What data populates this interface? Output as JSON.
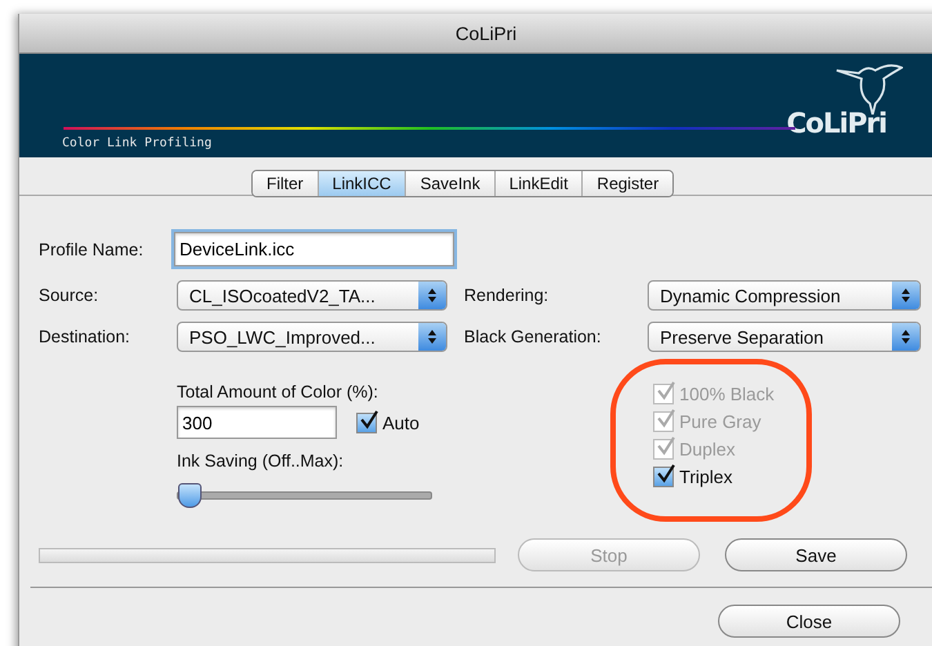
{
  "window": {
    "title": "CoLiPri"
  },
  "banner": {
    "logo": "CoLiPri",
    "tagline": "Color Link Profiling"
  },
  "tabs": [
    {
      "label": "Filter",
      "selected": false
    },
    {
      "label": "LinkICC",
      "selected": true
    },
    {
      "label": "SaveInk",
      "selected": false
    },
    {
      "label": "LinkEdit",
      "selected": false
    },
    {
      "label": "Register",
      "selected": false
    }
  ],
  "profile_name": {
    "label": "Profile Name:",
    "value": "DeviceLink.icc"
  },
  "popups": [
    {
      "label": "Source:",
      "value": "CL_ISOcoatedV2_TA..."
    },
    {
      "label": "Rendering:",
      "value": "Dynamic Compression"
    },
    {
      "label": "Destination:",
      "value": "PSO_LWC_Improved..."
    },
    {
      "label": "Black Generation:",
      "value": "Preserve Separation"
    }
  ],
  "total_amount": {
    "label": "Total Amount of Color (%):",
    "value": "300",
    "auto": {
      "label": "Auto",
      "checked": true
    }
  },
  "ink_saving": {
    "label": "Ink Saving (Off..Max):",
    "level": 0
  },
  "options": [
    {
      "label": "100% Black",
      "checked": true,
      "disabled": true
    },
    {
      "label": "Pure Gray",
      "checked": true,
      "disabled": true
    },
    {
      "label": "Duplex",
      "checked": true,
      "disabled": true
    },
    {
      "label": "Triplex",
      "checked": true,
      "disabled": false
    }
  ],
  "progress": {
    "level": 0
  },
  "buttons": [
    {
      "label": "Stop",
      "disabled": true
    },
    {
      "label": "Save",
      "disabled": false
    }
  ],
  "close_button": {
    "label": "Close"
  }
}
